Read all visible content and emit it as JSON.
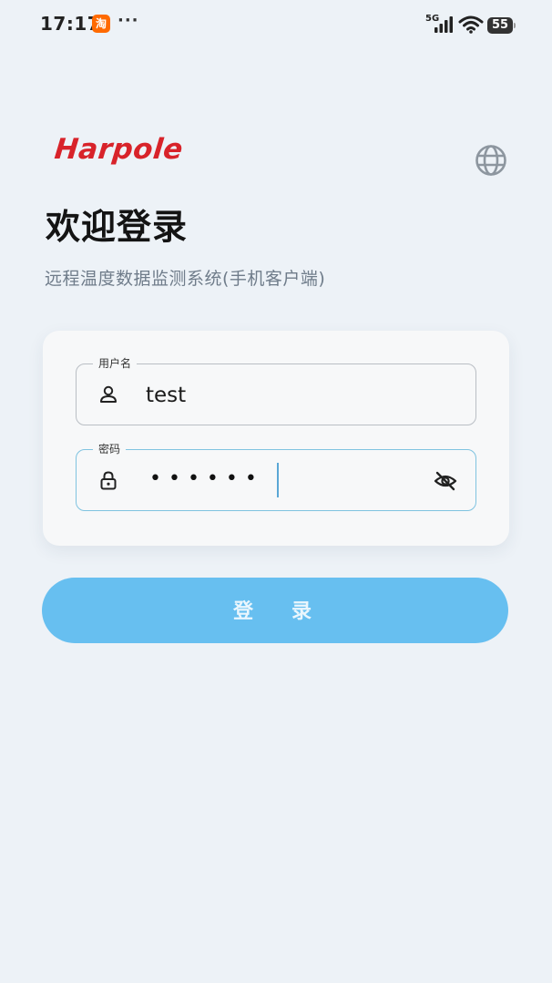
{
  "status_bar": {
    "time": "17:17",
    "app_badge": "淘",
    "more": "···",
    "network": "5G",
    "battery": "55"
  },
  "brand": {
    "logo_text": "Harpole"
  },
  "header": {
    "title": "欢迎登录",
    "subtitle": "远程温度数据监测系统(手机客户端)"
  },
  "form": {
    "username": {
      "label": "用户名",
      "value": "test"
    },
    "password": {
      "label": "密码",
      "masked_value": "••••••"
    },
    "submit_label": "登 录"
  },
  "colors": {
    "brand_red": "#d8232a",
    "accent_blue": "#67bff0",
    "focus_border": "#7fc3e0",
    "background": "#edf2f7"
  }
}
